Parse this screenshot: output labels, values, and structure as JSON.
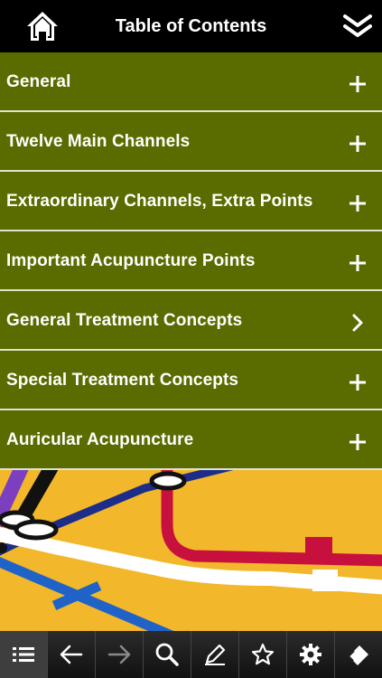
{
  "header": {
    "title": "Table of Contents"
  },
  "toc": {
    "items": [
      {
        "label": "General",
        "indicator": "plus-icon"
      },
      {
        "label": "Twelve Main Channels",
        "indicator": "plus-icon"
      },
      {
        "label": "Extraordinary Channels, Extra Points",
        "indicator": "plus-icon"
      },
      {
        "label": "Important Acupuncture Points",
        "indicator": "plus-icon"
      },
      {
        "label": "General Treatment Concepts",
        "indicator": "chevron-right-icon"
      },
      {
        "label": "Special Treatment Concepts",
        "indicator": "plus-icon"
      },
      {
        "label": "Auricular Acupuncture",
        "indicator": "plus-icon"
      }
    ]
  },
  "toolbar": {
    "buttons": [
      "list-icon",
      "back-arrow-icon",
      "forward-arrow-icon",
      "search-icon",
      "pencil-icon",
      "star-icon",
      "gear-icon",
      "eraser-icon"
    ]
  },
  "colors": {
    "item_background": "#5a6c00",
    "item_divider": "#dfe3cf",
    "map_background": "#f2b72a"
  }
}
